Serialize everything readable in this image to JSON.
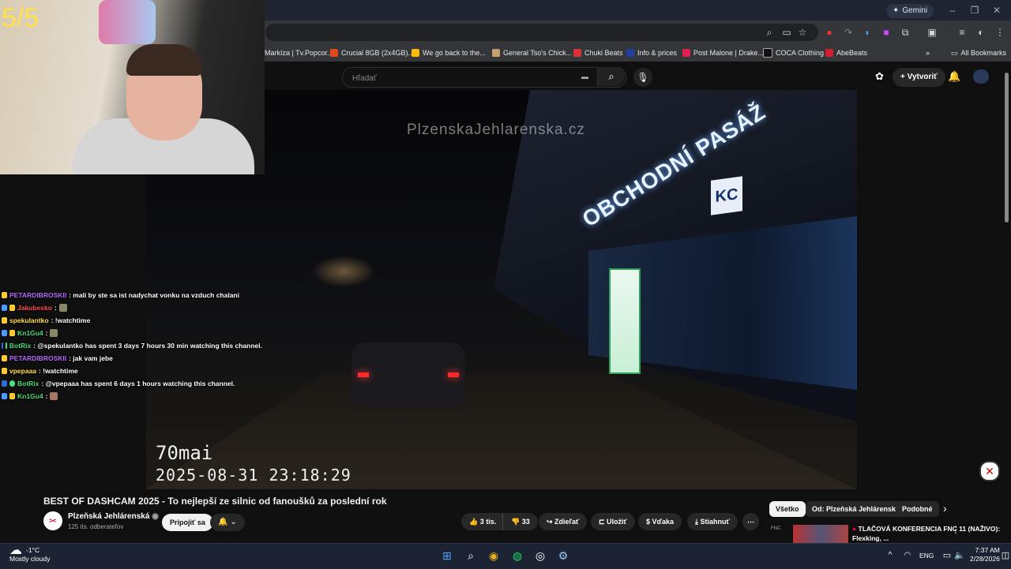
{
  "browser": {
    "gemini_label": "Gemini",
    "bookmarks": [
      {
        "label": "Markíza | Tv.Popcor...",
        "color": "#333"
      },
      {
        "label": "Crucial 8GB (2x4GB)...",
        "color": "#e04a1a"
      },
      {
        "label": "We go back to the...",
        "color": "#fbbc05"
      },
      {
        "label": "General Tso's Chick...",
        "color": "#c8a070"
      },
      {
        "label": "Chuki Beats",
        "color": "#d9303a"
      },
      {
        "label": "Info & prices",
        "color": "#2040a0"
      },
      {
        "label": "Post Malone | Drake...",
        "color": "#e02050"
      },
      {
        "label": "COCA Clothing",
        "color": "#111"
      },
      {
        "label": "AbeBeats",
        "color": "#d02030"
      }
    ],
    "all_bookmarks_label": "All Bookmarks"
  },
  "youtube": {
    "search_placeholder": "Hľadať",
    "create_label": "Vytvoriť",
    "video": {
      "watermark": "PlzenskaJehlarenska.cz",
      "dashcam_brand": "70mai",
      "dashcam_timestamp": "2025-08-31  23:18:29",
      "sign_text": "OBCHODNÍ PASÁŽ",
      "kc_sign": "KC"
    },
    "title": "BEST OF DASHCAM 2025 - To nejlepší ze silnic od fanoušků za poslední rok",
    "channel": {
      "name": "Plzeňská Jehlárenská",
      "subscribers": "125 tis. odberateľov"
    },
    "join_label": "Pripojiť sa",
    "actions": {
      "likes": "3 tis.",
      "dislikes": "33",
      "share": "Zdieľať",
      "save": "Uložiť",
      "thanks": "Vďaka",
      "download": "Stiahnuť"
    },
    "chips": [
      "Všetko",
      "Od: Plzeňská Jehlárenská",
      "Podobné"
    ],
    "next_video_title": "TLAČOVÁ KONFERENCIA FNC 11 (NAŽIVO): Flexking, ..."
  },
  "stream_overlay": {
    "counter": "5/5",
    "chat": [
      {
        "user": "PETARDIBROSKII",
        "user_color": "#b36bff",
        "text": ": mali by ste sa ist nadychat vonku na vzduch chalani"
      },
      {
        "user": "Jakubesko",
        "user_color": "#ff4d4d",
        "text": ":"
      },
      {
        "user": "spekulantko",
        "user_color": "#ffe04a",
        "text": ": !watchtime"
      },
      {
        "user": "Kn1Gu4",
        "user_color": "#4adf7a",
        "text": ":"
      },
      {
        "user": "BotRix",
        "user_color": "#4adf7a",
        "text": ": @spekulantko has spent 3 days 7 hours 30 min watching this channel."
      },
      {
        "user": "PETARDIBROSKII",
        "user_color": "#b36bff",
        "text": ": jak vam jebe"
      },
      {
        "user": "vpepaaa",
        "user_color": "#ffe04a",
        "text": ": !watchtime"
      },
      {
        "user": "BotRix",
        "user_color": "#4adf7a",
        "text": ": @vpepaaa has spent 6 days 1 hours watching this channel."
      },
      {
        "user": "Kn1Gu4",
        "user_color": "#4adf7a",
        "text": ":"
      }
    ]
  },
  "taskbar": {
    "temperature": "-1°C",
    "weather": "Mostly cloudy",
    "language": "ENG",
    "time": "7:37 AM",
    "date": "2/28/2026"
  }
}
